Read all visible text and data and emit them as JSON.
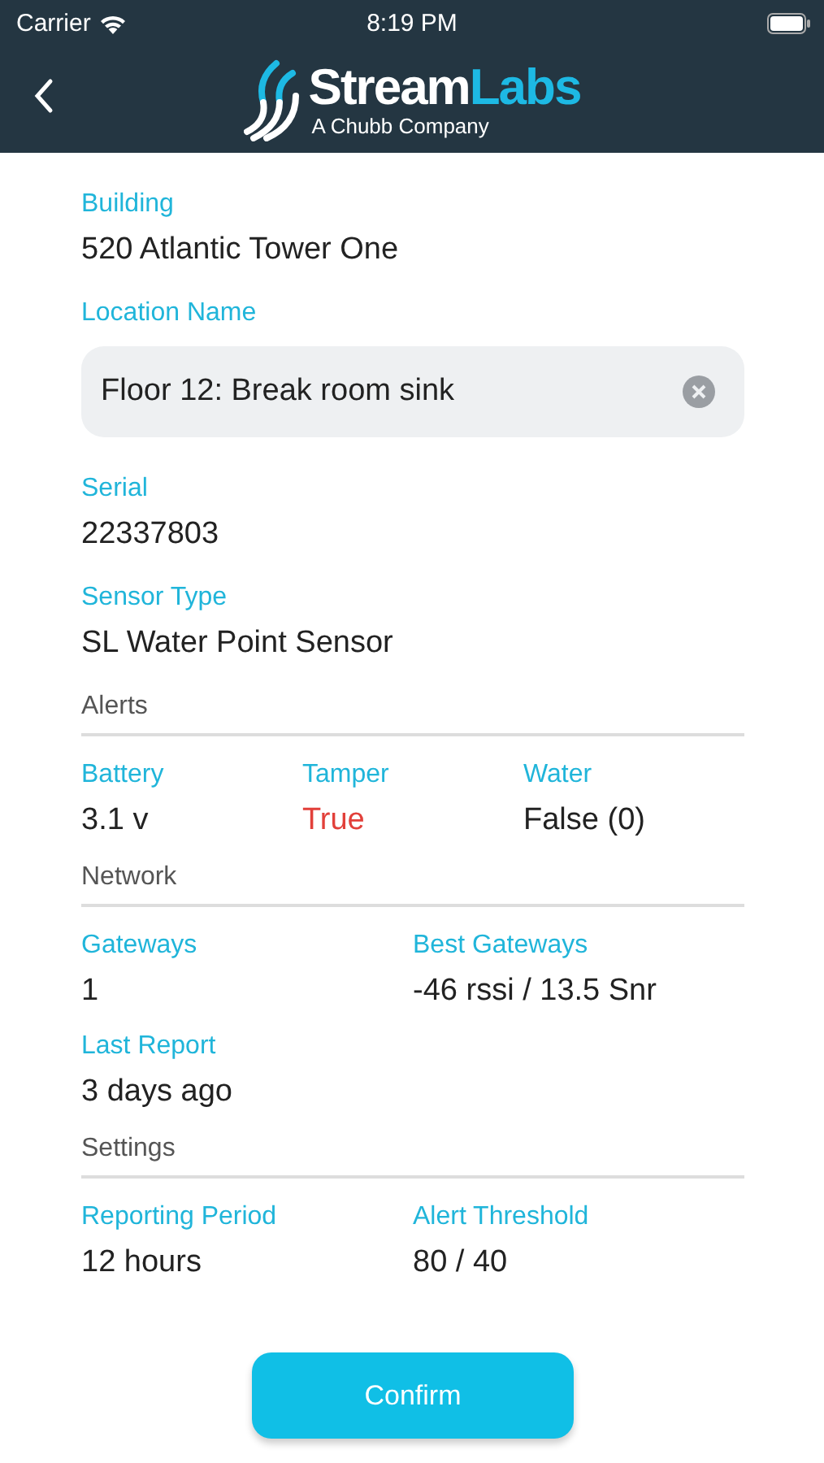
{
  "status_bar": {
    "carrier": "Carrier",
    "time": "8:19 PM"
  },
  "nav": {
    "logo": {
      "words": [
        {
          "text": "Stream",
          "color": "#ffffff"
        },
        {
          "text": "Labs",
          "color": "#1db9e4"
        }
      ],
      "tagline": "A Chubb Company"
    }
  },
  "fields": [
    {
      "kind": "text",
      "label": "Building",
      "value": "520 Atlantic Tower One"
    },
    {
      "kind": "input",
      "label": "Location Name",
      "value": "Floor 12: Break room sink"
    },
    {
      "kind": "text",
      "label": "Serial",
      "value": "22337803"
    },
    {
      "kind": "text",
      "label": "Sensor Type",
      "value": "SL Water Point Sensor"
    }
  ],
  "groups": [
    {
      "title": "Alerts",
      "kind": "triple",
      "rows": [
        [
          {
            "label": "Battery",
            "value": "3.1 v",
            "alert": false
          },
          {
            "label": "Tamper",
            "value": "True",
            "alert": true
          },
          {
            "label": "Water",
            "value": "False (0)",
            "alert": false
          }
        ]
      ]
    },
    {
      "title": "Network",
      "kind": "pair",
      "rows": [
        [
          {
            "label": "Gateways",
            "value": "1",
            "alert": false
          },
          {
            "label": "Best Gateways",
            "value": "-46 rssi / 13.5 Snr",
            "alert": false
          }
        ],
        [
          {
            "label": "Last Report",
            "value": "3 days ago",
            "alert": false
          }
        ]
      ]
    },
    {
      "title": "Settings",
      "kind": "pair",
      "rows": [
        [
          {
            "label": "Reporting Period",
            "value": "12 hours",
            "alert": false
          },
          {
            "label": "Alert Threshold",
            "value": "80 / 40",
            "alert": false
          }
        ]
      ]
    }
  ],
  "button": {
    "label": "Confirm"
  }
}
